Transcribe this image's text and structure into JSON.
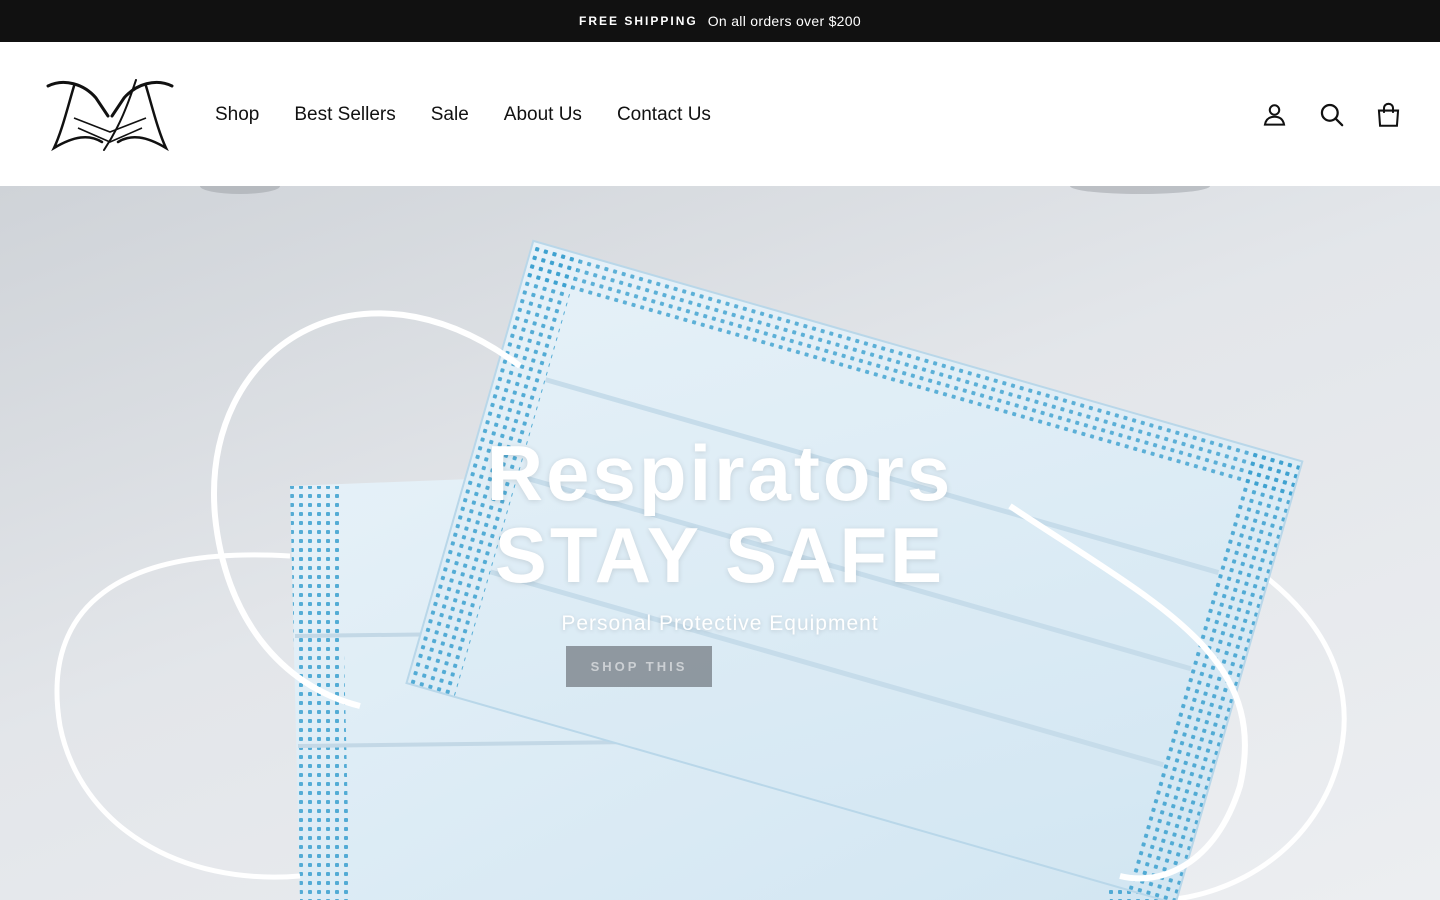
{
  "announcement": {
    "highlight": "FREE SHIPPING",
    "text": "On all orders over $200"
  },
  "header": {
    "logo_icon": "brand-logo",
    "nav": [
      {
        "label": "Shop"
      },
      {
        "label": "Best Sellers"
      },
      {
        "label": "Sale"
      },
      {
        "label": "About Us"
      },
      {
        "label": "Contact Us"
      }
    ],
    "icons": [
      "account-icon",
      "search-icon",
      "cart-icon"
    ]
  },
  "hero": {
    "title_line1": "Respirators",
    "title_line2": "STAY SAFE",
    "subtitle": "Personal Protective Equipment",
    "button_label": "SHOP THIS",
    "image_subject": "surgical-masks-image"
  },
  "colors": {
    "announcement_bg": "#111111",
    "mask_blue": "#3aa0cf",
    "text_dark": "#111111"
  }
}
